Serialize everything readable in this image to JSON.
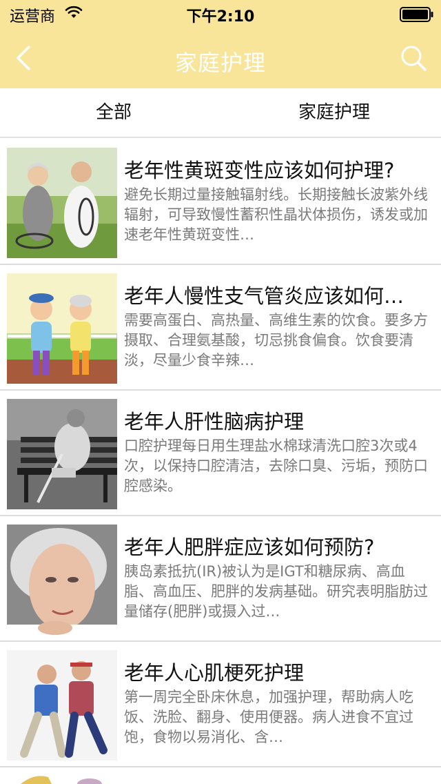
{
  "status": {
    "carrier": "运营商",
    "time": "下午2:10"
  },
  "nav": {
    "title": "家庭护理",
    "back_icon": "back-chevron-icon",
    "search_icon": "search-icon",
    "text_color": "#ffffff",
    "bar_color": "#f9e599"
  },
  "tabs": [
    {
      "label": "全部"
    },
    {
      "label": "家庭护理"
    }
  ],
  "articles": [
    {
      "title": "老年性黄斑变性应该如何护理?",
      "desc": "避免长期过量接触辐射线。长期接触长波紫外线辐射，可导致慢性蓄积性晶状体损伤，诱发或加速老年性黄斑变性…"
    },
    {
      "title": "老年人慢性支气管炎应该如何…",
      "desc": "需要高蛋白、高热量、高维生素的饮食。要多方摄取、合理氨基酸，切忌挑食偏食。饮食要清淡，尽量少食辛辣…"
    },
    {
      "title": "老年人肝性脑病护理",
      "desc": "口腔护理每日用生理盐水棉球清洗口腔3次或4次，以保持口腔清洁，去除口臭、污垢，预防口腔感染。"
    },
    {
      "title": "老年人肥胖症应该如何预防?",
      "desc": "胰岛素抵抗(IR)被认为是IGT和糖尿病、高血脂、高血压、肥胖的发病基础。研究表明脂肪过量储存(肥胖)或摄入过…"
    },
    {
      "title": "老年人心肌梗死护理",
      "desc": "第一周完全卧床休息，加强护理，帮助病人吃饭、洗脸、翻身、使用便器。病人进食不宜过饱，食物以易消化、含…"
    }
  ]
}
